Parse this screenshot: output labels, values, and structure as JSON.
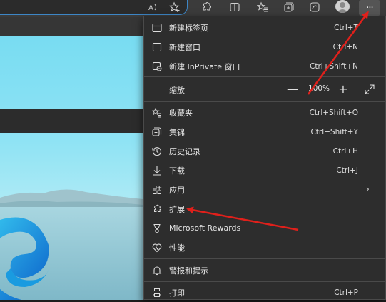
{
  "toolbar": {
    "icons": [
      "read-aloud-icon",
      "add-favorite-icon",
      "extensions-icon",
      "split-screen-icon",
      "favorites-icon",
      "collections-icon",
      "browser-essentials-icon",
      "profile-avatar",
      "settings-more-icon"
    ],
    "more_label": "···"
  },
  "menu": {
    "new_tab": {
      "label": "新建标签页",
      "shortcut": "Ctrl+T"
    },
    "new_window": {
      "label": "新建窗口",
      "shortcut": "Ctrl+N"
    },
    "new_inprivate": {
      "label": "新建 InPrivate 窗口",
      "shortcut": "Ctrl+Shift+N"
    },
    "zoom": {
      "label": "缩放",
      "value": "100%",
      "minus": "—",
      "plus": "+"
    },
    "favorites": {
      "label": "收藏夹",
      "shortcut": "Ctrl+Shift+O"
    },
    "collections": {
      "label": "集锦",
      "shortcut": "Ctrl+Shift+Y"
    },
    "history": {
      "label": "历史记录",
      "shortcut": "Ctrl+H"
    },
    "downloads": {
      "label": "下载",
      "shortcut": "Ctrl+J"
    },
    "apps": {
      "label": "应用",
      "chevron": "›"
    },
    "extensions": {
      "label": "扩展"
    },
    "rewards": {
      "label": "Microsoft Rewards"
    },
    "performance": {
      "label": "性能"
    },
    "alerts": {
      "label": "警报和提示"
    },
    "print": {
      "label": "打印",
      "shortcut": "Ctrl+P"
    }
  },
  "colors": {
    "menu_bg": "#2d2d2d",
    "toolbar_bg": "#3b3b3b",
    "annotation_red": "#e0201b",
    "address_focus": "#3d86c6"
  }
}
